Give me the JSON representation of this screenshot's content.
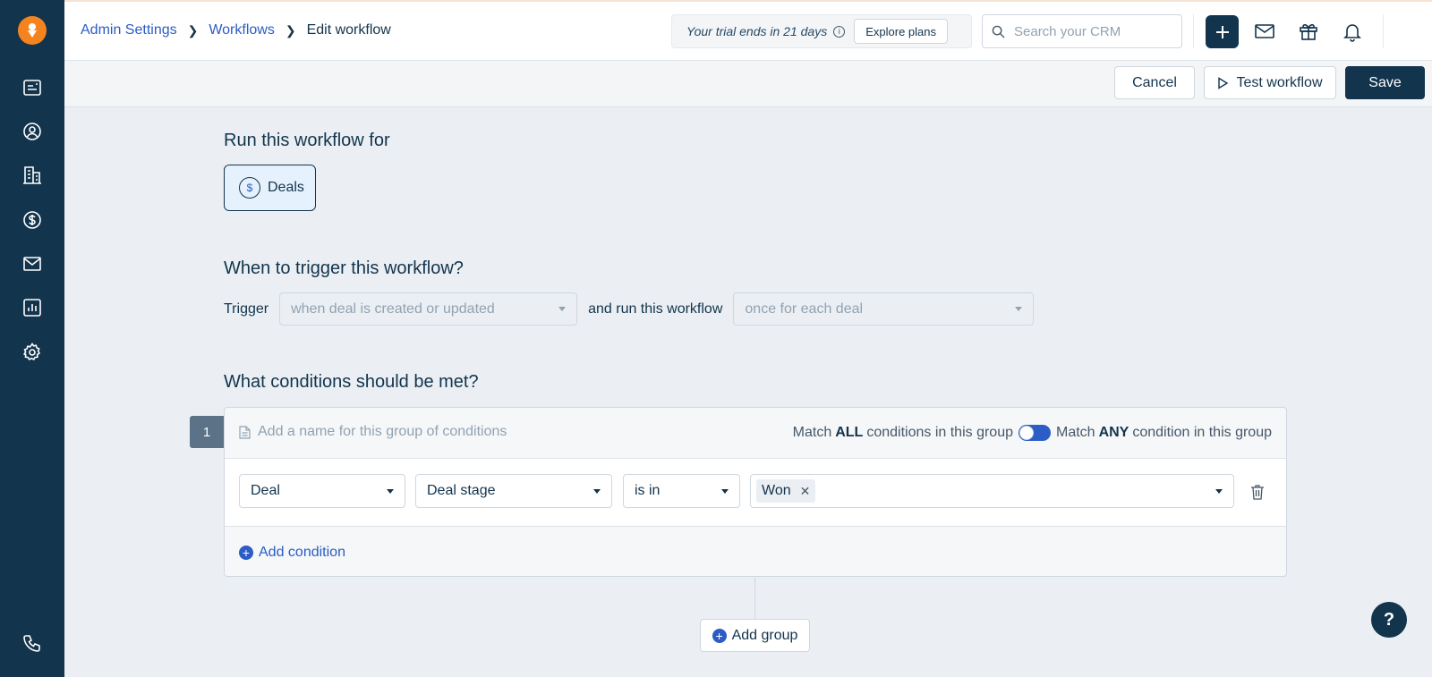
{
  "breadcrumb": {
    "items": [
      "Admin Settings",
      "Workflows"
    ],
    "current": "Edit workflow"
  },
  "trial": {
    "text": "Your trial ends in 21 days",
    "button": "Explore plans"
  },
  "search": {
    "placeholder": "Search your CRM"
  },
  "actions": {
    "cancel": "Cancel",
    "test": "Test workflow",
    "save": "Save"
  },
  "run_for": {
    "title": "Run this workflow for",
    "option": "Deals",
    "option_icon": "$"
  },
  "trigger": {
    "title": "When to trigger this workflow?",
    "label": "Trigger",
    "trigger_value": "when deal is created or updated",
    "run_label": "and run this workflow",
    "run_value": "once for each deal"
  },
  "conditions": {
    "title": "What conditions should be met?",
    "group_number": "1",
    "group_name_placeholder": "Add a name for this group of conditions",
    "match_all_prefix": "Match",
    "match_all_bold": "ALL",
    "match_all_suffix": "conditions in this group",
    "match_any_prefix": "Match",
    "match_any_bold": "ANY",
    "match_any_suffix": "condition in this group",
    "toggle_state": "ANY",
    "row": {
      "entity": "Deal",
      "field": "Deal stage",
      "operator": "is in",
      "values": [
        "Won"
      ]
    },
    "add_condition": "Add condition",
    "add_group": "Add group"
  },
  "help": "?",
  "colors": {
    "sidebar": "#12344d",
    "accent": "#2c5cc5",
    "logo": "#f5841f",
    "page_bg": "#ebeff3"
  }
}
